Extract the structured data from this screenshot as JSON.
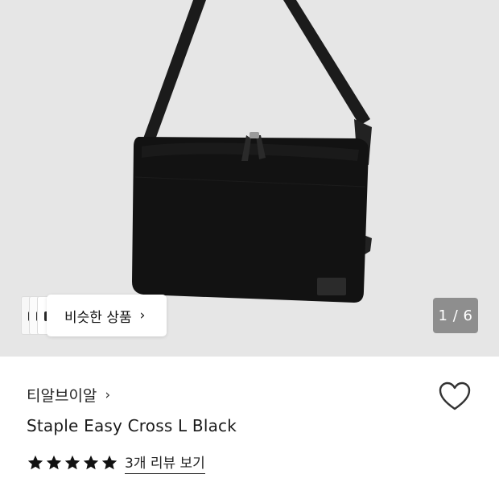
{
  "gallery": {
    "similar_label": "비슷한 상품",
    "similar_chevron": "›",
    "counter": "1 / 6",
    "background_color": "#e6e6e6"
  },
  "product": {
    "brand": "티알브이알",
    "brand_chevron": "›",
    "title": "Staple Easy Cross L Black",
    "rating": {
      "value": 5,
      "max": 5
    },
    "review_link": "3개 리뷰 보기"
  },
  "icons": {
    "heart": "heart-outline-icon",
    "star": "star-filled-icon"
  }
}
